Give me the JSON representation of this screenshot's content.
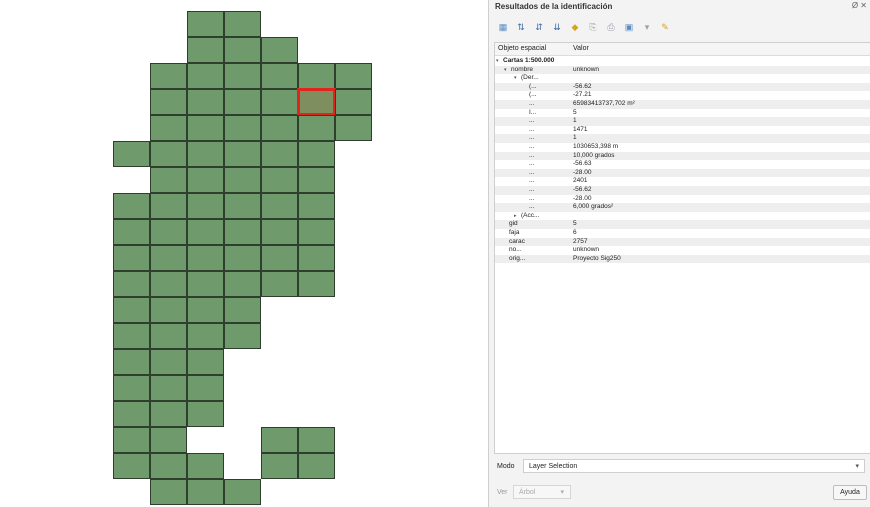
{
  "panel": {
    "title": "Resultados de la identificación",
    "close_glyph": "Ø ✕",
    "toolbar_icons": [
      "tree-icon",
      "expand-icon",
      "collapse-icon",
      "expand-new-icon",
      "highlight-icon",
      "copy-icon",
      "print-icon",
      "select-icon",
      "dropdown-icon",
      "tool-icon"
    ]
  },
  "tree": {
    "col_feature": "Objeto espacial",
    "col_value": "Valor",
    "rows": [
      {
        "twisty": "▾",
        "key": "Cartas 1:500.000",
        "value": "",
        "bold": true
      },
      {
        "twisty": "▾",
        "key": "nombre",
        "value": "unknown"
      },
      {
        "twisty": "▾",
        "key": "(Der...",
        "value": ""
      },
      {
        "twisty": "",
        "key": "(...",
        "value": "-56.62"
      },
      {
        "twisty": "",
        "key": "(...",
        "value": "-27.21"
      },
      {
        "twisty": "",
        "key": "...",
        "value": "65983413737,702 m²"
      },
      {
        "twisty": "",
        "key": "I...",
        "value": "5"
      },
      {
        "twisty": "",
        "key": "...",
        "value": "1"
      },
      {
        "twisty": "",
        "key": "...",
        "value": "1471"
      },
      {
        "twisty": "",
        "key": "...",
        "value": "1"
      },
      {
        "twisty": "",
        "key": "...",
        "value": "1030653,398 m"
      },
      {
        "twisty": "",
        "key": "...",
        "value": "10,000 grados"
      },
      {
        "twisty": "",
        "key": "...",
        "value": "-56.63"
      },
      {
        "twisty": "",
        "key": "...",
        "value": "-28.00"
      },
      {
        "twisty": "",
        "key": "...",
        "value": "2401"
      },
      {
        "twisty": "",
        "key": "...",
        "value": "-56.62"
      },
      {
        "twisty": "",
        "key": "...",
        "value": "-28.00"
      },
      {
        "twisty": "",
        "key": "...",
        "value": "6,000 grados²"
      },
      {
        "twisty": "▸",
        "key": "(Acc...",
        "value": ""
      },
      {
        "twisty": "",
        "key": "gid",
        "value": "5"
      },
      {
        "twisty": "",
        "key": "faja",
        "value": "6"
      },
      {
        "twisty": "",
        "key": "carac",
        "value": "2757"
      },
      {
        "twisty": "",
        "key": "no...",
        "value": "unknown"
      },
      {
        "twisty": "",
        "key": "orig...",
        "value": "Proyecto Sig250"
      }
    ]
  },
  "mode": {
    "label": "Modo",
    "value": "Layer Selection"
  },
  "view": {
    "label": "Ver",
    "value": "Árbol"
  },
  "help_label": "Ayuda",
  "colors": {
    "cell": "#6e9a6c",
    "selected_outline": "#e0261c"
  }
}
